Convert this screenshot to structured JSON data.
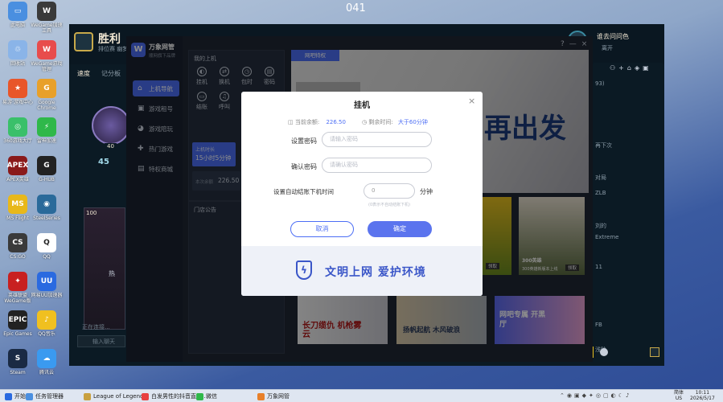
{
  "screen": {
    "top_number": "041"
  },
  "desktop_icons": [
    {
      "label": "此电脑",
      "color": "#4a8fe0",
      "glyph": "▭"
    },
    {
      "label": "WeGame加速工具",
      "color": "#3a3a3a",
      "glyph": "W"
    },
    {
      "label": "回收站",
      "color": "#8ab4e8",
      "glyph": "♲"
    },
    {
      "label": "WeGame游戏管理",
      "color": "#e84c4c",
      "glyph": "W"
    },
    {
      "label": "易游·游戏中心",
      "color": "#e8562a",
      "glyph": "★"
    },
    {
      "label": "Google Chrome",
      "color": "#e8a02a",
      "glyph": "G"
    },
    {
      "label": "360游戏大厅",
      "color": "#3ac06a",
      "glyph": "◎"
    },
    {
      "label": "雷神加速",
      "color": "#2fb84a",
      "glyph": "⚡"
    },
    {
      "label": "APEX英雄",
      "color": "#8a1a1a",
      "glyph": "APEX"
    },
    {
      "label": "G-HUB",
      "color": "#222",
      "glyph": "G"
    },
    {
      "label": "MS Flight",
      "color": "#e8b81a",
      "glyph": "MS"
    },
    {
      "label": "SteelSeries",
      "color": "#2a6a9a",
      "glyph": "◉"
    },
    {
      "label": "CS:GO",
      "color": "#3a3a3a",
      "glyph": "CS"
    },
    {
      "label": "QQ",
      "color": "#fff",
      "glyph": "Q"
    },
    {
      "label": "英雄联盟WeGame版",
      "color": "#c82020",
      "glyph": "✦"
    },
    {
      "label": "网易UU加速器",
      "color": "#2a6ae0",
      "glyph": "UU"
    },
    {
      "label": "Epic Games",
      "color": "#222",
      "glyph": "EPIC"
    },
    {
      "label": "QQ音乐",
      "color": "#f0c020",
      "glyph": "♪"
    },
    {
      "label": "Steam",
      "color": "#1a2a44",
      "glyph": "S"
    },
    {
      "label": "腾讯云",
      "color": "#3a9af0",
      "glyph": "☁"
    }
  ],
  "lol_client": {
    "title": "胜利",
    "subtitle": "排位赛 幽梦 胜利",
    "tabs": [
      "速度",
      "记分板"
    ],
    "level": "40",
    "lp": "45",
    "right_user": "谁去问问色",
    "right_status": "离开",
    "right_lines": [
      "93)",
      "再下次",
      "对局",
      "ZLB",
      "刘的",
      "Extreme",
      "11",
      "FB",
      "浅阶"
    ],
    "card_level": "100",
    "card_label": "热"
  },
  "wanxiang": {
    "app_name": "万象网管",
    "app_sub": "顺网旗下品牌",
    "nav": [
      {
        "label": "上机导航",
        "icon": "⌂",
        "active": true
      },
      {
        "label": "游戏租号",
        "icon": "▣",
        "active": false
      },
      {
        "label": "游戏陪玩",
        "icon": "◕",
        "active": false
      },
      {
        "label": "热门游戏",
        "icon": "✚",
        "active": false
      },
      {
        "label": "特权商城",
        "icon": "▤",
        "active": false
      }
    ],
    "my_machine_title": "我的上机",
    "quick_actions": [
      "挂机",
      "换机",
      "包时",
      "密码",
      "结账",
      "呼叫"
    ],
    "time_label": "上机时长",
    "time_value": "15小时5分钟",
    "balance_label": "本次余额",
    "balance_value": "226.50",
    "notice_title": "门店公告",
    "banner_tab": "网吧特权",
    "banner_text": "再出发",
    "game_tiles": [
      {
        "label": "300英雄",
        "sub": "300英雄新版本上线",
        "btn": "领取"
      },
      {
        "label": "",
        "sub": "",
        "btn": "领取"
      }
    ],
    "bottom_tiles": [
      "长刀缆仇 机枪雾云",
      "扬帆起航 木风破浪",
      "网吧专属 开黑厅"
    ]
  },
  "dialog": {
    "title": "挂机",
    "close": "×",
    "balance_label": "当前余额:",
    "balance_value": "226.50",
    "time_label": "剩余时间:",
    "time_value": "大于60分钟",
    "pwd_label": "设置密码",
    "pwd_placeholder": "请输入密码",
    "confirm_label": "确认密码",
    "confirm_placeholder": "请确认密码",
    "auto_label": "设置自动结账下机时间",
    "auto_value": "0",
    "auto_unit": "分钟",
    "auto_hint": "(0表示不自动结账下机)",
    "cancel": "取消",
    "confirm": "确定",
    "slogan": "文明上网  爱护环境"
  },
  "chat_bar": {
    "status": "正在连接...",
    "input_placeholder": "输入聊天"
  },
  "taskbar": {
    "start": "开始",
    "items": [
      {
        "label": "任务管理器",
        "color": "#4a8fe0"
      },
      {
        "label": "League of Legends",
        "color": "#c8a040"
      },
      {
        "label": "白发男性的抖音直播…",
        "color": "#e84040"
      },
      {
        "label": "微信",
        "color": "#2fb84a"
      },
      {
        "label": "万象网管",
        "color": "#e8802a"
      }
    ],
    "lang_top": "简体",
    "lang_bottom": "US",
    "time": "10:11",
    "date": "2026/5/17"
  }
}
